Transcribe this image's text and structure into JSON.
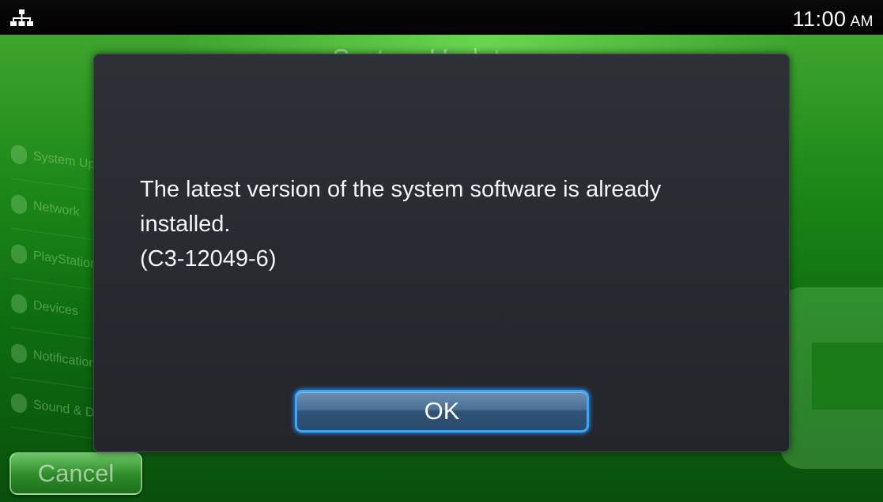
{
  "status_bar": {
    "network_icon": "network-icon",
    "time": "11:00",
    "ampm": "AM"
  },
  "background_app": {
    "title": "System Update",
    "settings_items": [
      {
        "label": "System Update",
        "icon": "refresh-icon"
      },
      {
        "label": "Network",
        "icon": "globe-icon"
      },
      {
        "label": "PlayStation™Network",
        "icon": "playstation-icon"
      },
      {
        "label": "Devices",
        "icon": "devices-icon"
      },
      {
        "label": "Notifications",
        "icon": "notification-icon"
      },
      {
        "label": "Sound & Display",
        "icon": "sound-icon"
      }
    ],
    "cancel_label": "Cancel",
    "accent_color": "#2d8a28"
  },
  "dialog": {
    "message_line1": "The latest version of the system software is already",
    "message_line2": "installed.",
    "error_code": "(C3-12049-6)",
    "ok_label": "OK",
    "focus_color": "#36a8ff"
  }
}
